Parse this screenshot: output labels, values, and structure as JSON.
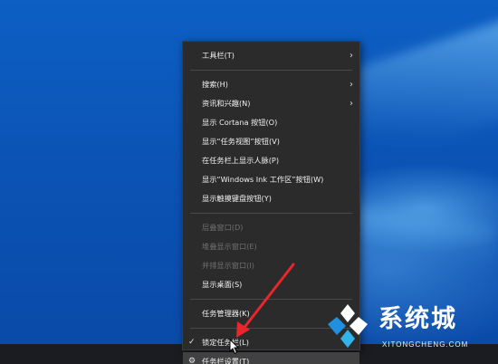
{
  "menu": {
    "items": [
      {
        "label": "工具栏(T)",
        "submenu": true
      },
      {
        "label": "搜索(H)",
        "submenu": true
      },
      {
        "label": "资讯和兴趣(N)",
        "submenu": true
      },
      {
        "label": "显示 Cortana 按钮(O)"
      },
      {
        "label": "显示“任务视图”按钮(V)"
      },
      {
        "label": "在任务栏上显示人脉(P)"
      },
      {
        "label": "显示“Windows Ink 工作区”按钮(W)"
      },
      {
        "label": "显示触摸键盘按钮(Y)"
      },
      {
        "label": "层叠窗口(D)",
        "disabled": true
      },
      {
        "label": "堆叠显示窗口(E)",
        "disabled": true
      },
      {
        "label": "并排显示窗口(I)",
        "disabled": true
      },
      {
        "label": "显示桌面(S)"
      },
      {
        "label": "任务管理器(K)"
      },
      {
        "label": "锁定任务栏(L)",
        "checked": true
      },
      {
        "label": "任务栏设置(T)",
        "icon": "gear-icon",
        "highlighted": true
      }
    ]
  },
  "icons": {
    "chevron": "chevron-right-icon",
    "check": "checkmark-icon",
    "gear": "gear-icon"
  },
  "glyphs": {
    "chevron": "›",
    "check": "✓",
    "gear": "⚙"
  },
  "watermark": {
    "title": "系统城",
    "subtitle": "XITONGCHENG.COM"
  },
  "colors": {
    "menu_bg": "#2b2b2b",
    "arrow": "#e8262b",
    "desktop": "#0b54b6"
  }
}
